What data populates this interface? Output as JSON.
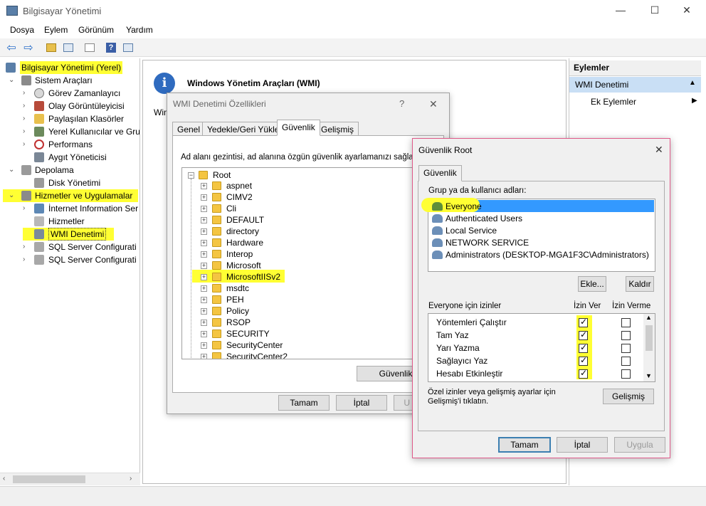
{
  "window": {
    "title": "Bilgisayar Yönetimi",
    "controls": {
      "minimize": "—",
      "maximize": "☐",
      "close": "✕"
    }
  },
  "menu": [
    "Dosya",
    "Eylem",
    "Görünüm",
    "Yardım"
  ],
  "highlight_color": "#ffff33",
  "tree": {
    "root": "Bilgisayar Yönetimi (Yerel)",
    "items": [
      {
        "label": "Sistem Araçları",
        "icon": "tools-icon"
      },
      {
        "label": "Görev Zamanlayıcı",
        "icon": "clock-icon"
      },
      {
        "label": "Olay Görüntüleyicisi",
        "icon": "event-viewer-icon"
      },
      {
        "label": "Paylaşılan Klasörler",
        "icon": "shared-folder-icon"
      },
      {
        "label": "Yerel Kullanıcılar ve Gru",
        "icon": "users-icon"
      },
      {
        "label": "Performans",
        "icon": "performance-icon"
      },
      {
        "label": "Aygıt Yöneticisi",
        "icon": "device-manager-icon"
      },
      {
        "label": "Depolama",
        "icon": "storage-icon"
      },
      {
        "label": "Disk Yönetimi",
        "icon": "disk-icon"
      },
      {
        "label": "Hizmetler ve Uygulamalar",
        "icon": "services-apps-icon"
      },
      {
        "label": "İnternet Information Ser",
        "icon": "iis-icon"
      },
      {
        "label": "Hizmetler",
        "icon": "services-icon"
      },
      {
        "label": "WMI Denetimi",
        "icon": "wmi-icon"
      },
      {
        "label": "SQL Server Configurati",
        "icon": "sql-icon"
      },
      {
        "label": "SQL Server Configurati",
        "icon": "sql-icon"
      }
    ]
  },
  "middle": {
    "heading": "Windows Yönetim Araçları (WMI)",
    "partial_text": "Win"
  },
  "actions": {
    "header": "Eylemler",
    "selected": "WMI Denetimi",
    "more": "Ek Eylemler"
  },
  "dialog1": {
    "title": "WMI Denetimi Özellikleri",
    "help": "?",
    "close": "✕",
    "tabs": [
      "Genel",
      "Yedekle/Geri Yükle",
      "Güvenlik",
      "Gelişmiş"
    ],
    "description": "Ad alanı gezintisi, ad alanına özgün güvenlik ayarlamanızı sağlar.",
    "root": "Root",
    "namespaces": [
      "aspnet",
      "CIMV2",
      "Cli",
      "DEFAULT",
      "directory",
      "Hardware",
      "Interop",
      "Microsoft",
      "MicrosoftIISv2",
      "msdtc",
      "PEH",
      "Policy",
      "RSOP",
      "SECURITY",
      "SecurityCenter",
      "SecurityCenter2"
    ],
    "security_button": "Güvenlik",
    "ok": "Tamam",
    "cancel": "İptal",
    "apply_partial": "U"
  },
  "dialog2": {
    "title": "Güvenlik Root",
    "close": "✕",
    "tab": "Güvenlik",
    "group_label": "Grup ya da kullanıcı adları:",
    "users": [
      "Everyone",
      "Authenticated Users",
      "Local Service",
      "NETWORK SERVICE",
      "Administrators (DESKTOP-MGA1F3C\\Administrators)"
    ],
    "add": "Ekle...",
    "remove": "Kaldır",
    "perm_label": "Everyone için izinler",
    "allow_header": "İzin Ver",
    "deny_header": "İzin Verme",
    "permissions": [
      {
        "name": "Yöntemleri Çalıştır",
        "allow": true,
        "deny": false
      },
      {
        "name": "Tam Yaz",
        "allow": true,
        "deny": false
      },
      {
        "name": "Yarı Yazma",
        "allow": true,
        "deny": false
      },
      {
        "name": "Sağlayıcı Yaz",
        "allow": true,
        "deny": false
      },
      {
        "name": "Hesabı Etkinleştir",
        "allow": true,
        "deny": false
      }
    ],
    "advanced_text": "Özel izinler veya gelişmiş ayarlar için Gelişmiş'i tıklatın.",
    "advanced": "Gelişmiş",
    "ok": "Tamam",
    "cancel": "İptal",
    "apply": "Uygula"
  }
}
